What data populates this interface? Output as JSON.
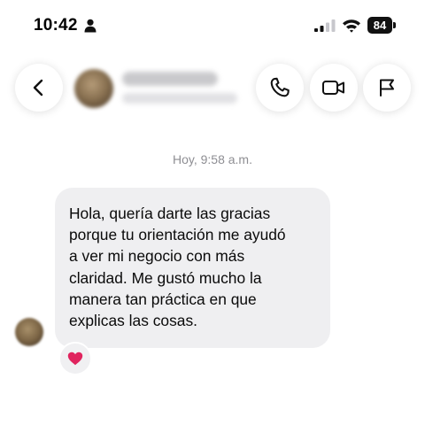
{
  "status_bar": {
    "time": "10:42",
    "battery": "84",
    "icons": [
      "person-icon",
      "signal-icon",
      "wifi-icon",
      "battery-icon"
    ]
  },
  "header": {
    "icons": [
      "back-icon",
      "phone-icon",
      "video-icon",
      "flag-icon"
    ]
  },
  "conversation": {
    "timestamp": "Hoy, 9:58 a.m.",
    "messages": [
      {
        "lines": [
          "Hola, quería darte las gracias",
          "porque tu orientación me ayudó",
          "a ver mi negocio con más",
          "claridad. Me gustó mucho la",
          "manera tan práctica en que",
          "explicas las cosas."
        ],
        "reaction": "❤️"
      }
    ]
  },
  "colors": {
    "bubble": "#efeff1",
    "timestamp": "#8e8e93",
    "reaction_heart": "#e0245e"
  }
}
